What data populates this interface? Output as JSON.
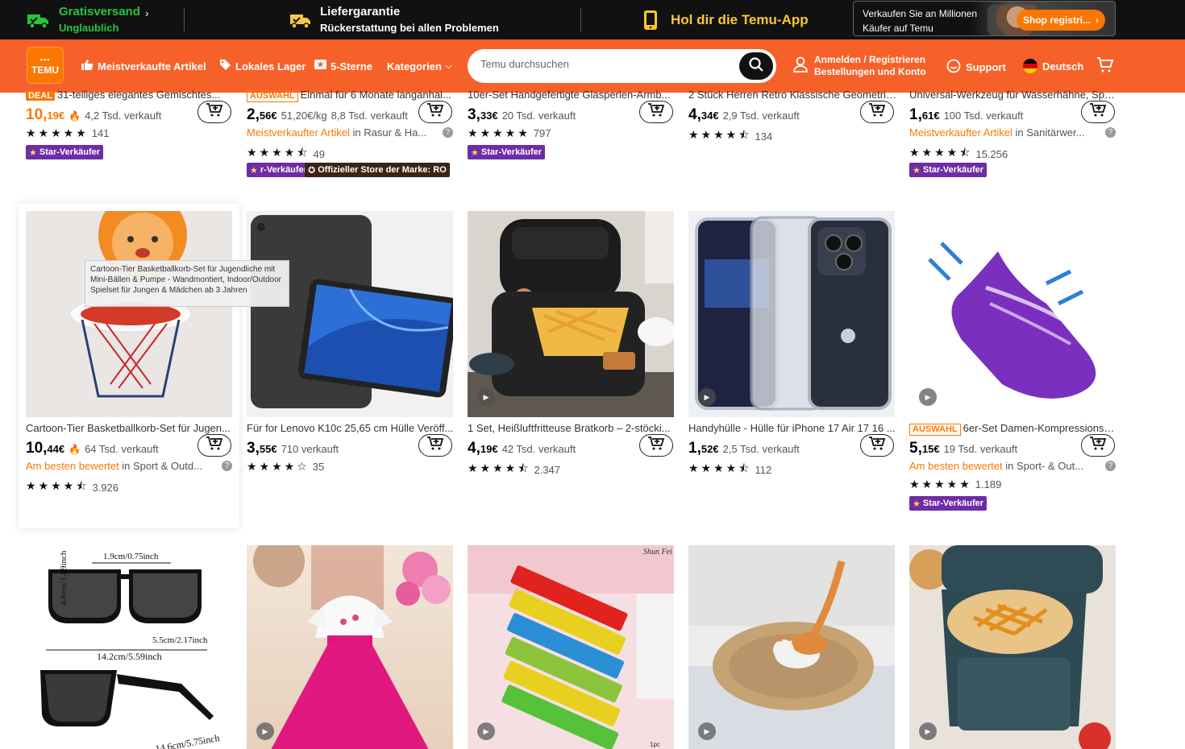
{
  "topbar": {
    "shipping_title": "Gratisversand",
    "shipping_sub": "Unglaublich",
    "guarantee_title": "Liefergarantie",
    "guarantee_sub": "Rückerstattung bei allen Problemen",
    "app_title": "Hol dir die Temu-App",
    "seller_line1": "Verkaufen Sie an Millionen",
    "seller_line2": "Käufer auf Temu",
    "seller_btn": "Shop registri..."
  },
  "header": {
    "logo_text": "TEMU",
    "nav": [
      "Meistverkaufte Artikel",
      "Lokales Lager",
      "5-Sterne",
      "Kategorien"
    ],
    "search_placeholder": "Temu durchsuchen",
    "account_line1": "Anmelden / Registrieren",
    "account_line2": "Bestellungen und Konto",
    "support": "Support",
    "language": "Deutsch"
  },
  "colors": {
    "brand_orange": "#fb7701",
    "header_bg": "#f6612a",
    "badge_purple": "#6e2ca5"
  },
  "row1": [
    {
      "tag": "DEAL",
      "title": "31-teiliges elegantes Gemischtes...",
      "price_int": "10,",
      "price_dec": "19",
      "currency": "€",
      "orange": true,
      "flame": true,
      "sold": "4,2 Tsd. verkauft",
      "rating_count": "141",
      "badge": "Star-Verkäufer"
    },
    {
      "tag": "AUSWAHL",
      "title": "Einmal für 6 Monate langanhal...",
      "price_int": "2,",
      "price_dec": "56",
      "currency": "€",
      "unit": "51,20€/kg",
      "sold": "8,8 Tsd. verkauft",
      "rank_hl": "Meistverkaufter Artikel",
      "rank_rest": " in Rasur & Ha...",
      "rating_count": "49",
      "badge": "r-Verkäufer",
      "badge2": "Offizieller Store der Marke: RO"
    },
    {
      "title": "10er-Set Handgefertigte Glasperlen-Armb...",
      "price_int": "3,",
      "price_dec": "33",
      "currency": "€",
      "sold": "20 Tsd. verkauft",
      "rating_count": "797",
      "badge": "Star-Verkäufer"
    },
    {
      "title": "2 Stück Herren Retro Klassische Geometris...",
      "price_int": "4,",
      "price_dec": "34",
      "currency": "€",
      "sold": "2,9 Tsd. verkauft",
      "rating_count": "134"
    },
    {
      "title": "Universal-Werkzeug für Wasserhähne, Spe...",
      "price_int": "1,",
      "price_dec": "61",
      "currency": "€",
      "sold": "100 Tsd. verkauft",
      "rank_hl": "Meistverkaufter Artikel",
      "rank_rest": " in Sanitärwer...",
      "rating_count": "15.256",
      "badge": "Star-Verkäufer"
    }
  ],
  "row2": [
    {
      "title": "Cartoon-Tier Basketballkorb-Set für Jugen...",
      "price_int": "10,",
      "price_dec": "44",
      "currency": "€",
      "flame": true,
      "sold": "64 Tsd. verkauft",
      "rank_hl": "Am besten bewertet",
      "rank_rest": " in Sport & Outd...",
      "rating_count": "3.926"
    },
    {
      "title": "Für for Lenovo K10c 25,65 cm Hülle Veröff...",
      "price_int": "3,",
      "price_dec": "55",
      "currency": "€",
      "sold": "710 verkauft",
      "rating_count": "35"
    },
    {
      "title": "1 Set, Heißluftfritteuse Bratkorb – 2-stöcki...",
      "price_int": "4,",
      "price_dec": "19",
      "currency": "€",
      "sold": "42 Tsd. verkauft",
      "rating_count": "2.347"
    },
    {
      "title": "Handyhülle - Hülle für iPhone 17 Air 17 16 ...",
      "price_int": "1,",
      "price_dec": "52",
      "currency": "€",
      "sold": "2,5 Tsd. verkauft",
      "rating_count": "112"
    },
    {
      "tag": "AUSWAHL",
      "title": "6er-Set Damen-Kompressionss...",
      "price_int": "5,",
      "price_dec": "15",
      "currency": "€",
      "sold": "19 Tsd. verkauft",
      "rank_hl": "Am besten bewertet",
      "rank_rest": " in Sport- & Out...",
      "rating_count": "1.189",
      "badge": "Star-Verkäufer"
    }
  ],
  "tooltip": "Cartoon-Tier Basketballkorb-Set für Jugendliche mit Mini-Bällen & Pumpe - Wandmontiert, Indoor/Outdoor Spielset für Jungen & Mädchen ab 3 Jahren",
  "row3_labels": {
    "sunglasses_top": "1.9cm/0.75inch",
    "sunglasses_side": "4.8cm/1.89inch",
    "sunglasses_mid": "5.5cm/2.17inch",
    "sunglasses_width": "14.2cm/5.59inch",
    "sunglasses_bottom": "14.6cm/5.75inch",
    "harmonica_brand": "Shun Fei",
    "harmonica_count": "1pc"
  }
}
